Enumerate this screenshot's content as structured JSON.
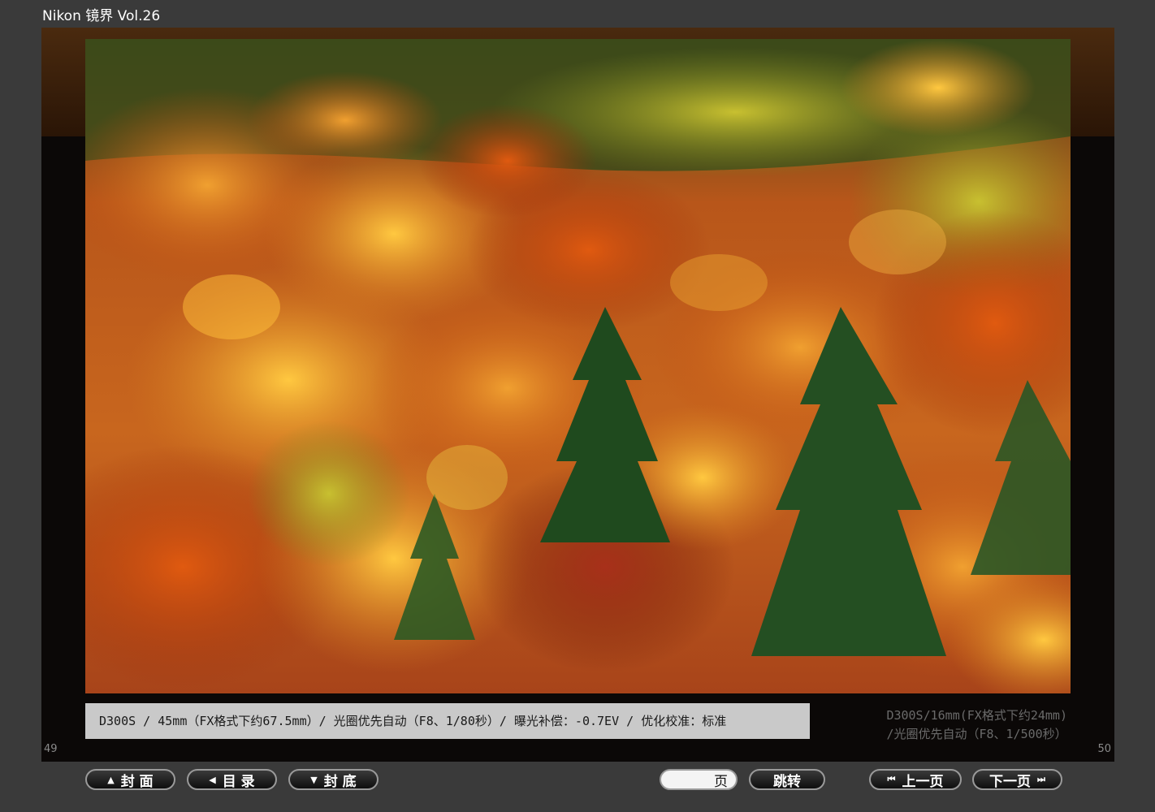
{
  "window": {
    "title": "Nikon 镜界 Vol.26"
  },
  "spread": {
    "left_page": "49",
    "right_page": "50",
    "background_caption_lines": [
      "D300S/16mm(FX格式下约24mm)",
      "/光圈优先自动（F8、1/500秒）"
    ]
  },
  "photo": {
    "subject": "autumn-forest-photo",
    "caption": "D300S / 45mm（FX格式下约67.5mm）/ 光圈优先自动（F8、1/80秒）/ 曝光补偿：-0.7EV / 优化校准：标准"
  },
  "toolbar": {
    "cover_label": "封 面",
    "toc_label": "目 录",
    "back_cover_label": "封 底",
    "page_input_value": "",
    "page_suffix": "页",
    "jump_label": "跳转",
    "prev_label": "上一页",
    "next_label": "下一页"
  },
  "colors": {
    "background": "#3a3a3a",
    "viewer": "#0b0807",
    "caption_bar": "#c9c9c9"
  }
}
